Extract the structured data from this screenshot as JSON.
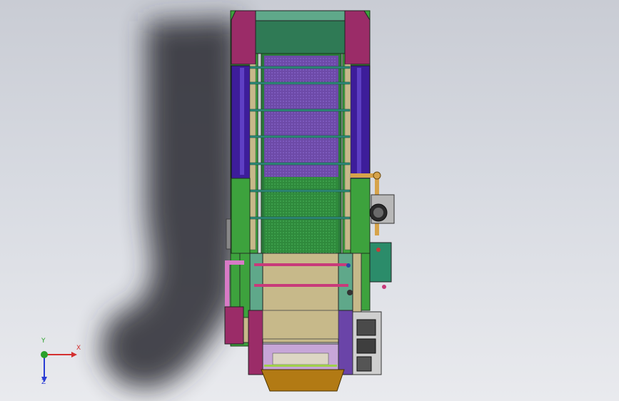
{
  "viewport": {
    "background_top": "#c9ccd4",
    "background_bottom": "#e9eaee",
    "shadow_color": "#2a2b30"
  },
  "model": {
    "frame_green": "#3da23d",
    "frame_dark_green": "#1f6a2a",
    "magenta_panel": "#9b2c68",
    "teal_panel": "#5fa88a",
    "purple_panel": "#3d1d9a",
    "khaki": "#c7b98a",
    "mesh_purple": "#6d4aa8",
    "mesh_green": "#2f8a3c",
    "cross_bar": "#2f8a7a",
    "pink_bar": "#c83a7a",
    "orange_pipe": "#d6a34a",
    "pink_pipe": "#d87ac6",
    "control_box": "#2b8c6a",
    "hopper_brown": "#b27a14",
    "hopper_lilac": "#c7a6d8"
  },
  "triad": {
    "x_label": "X",
    "y_label": "Y",
    "z_label": "Z",
    "x_color": "#d43030",
    "y_color": "#2aa02a",
    "z_color": "#2a3cd4"
  }
}
